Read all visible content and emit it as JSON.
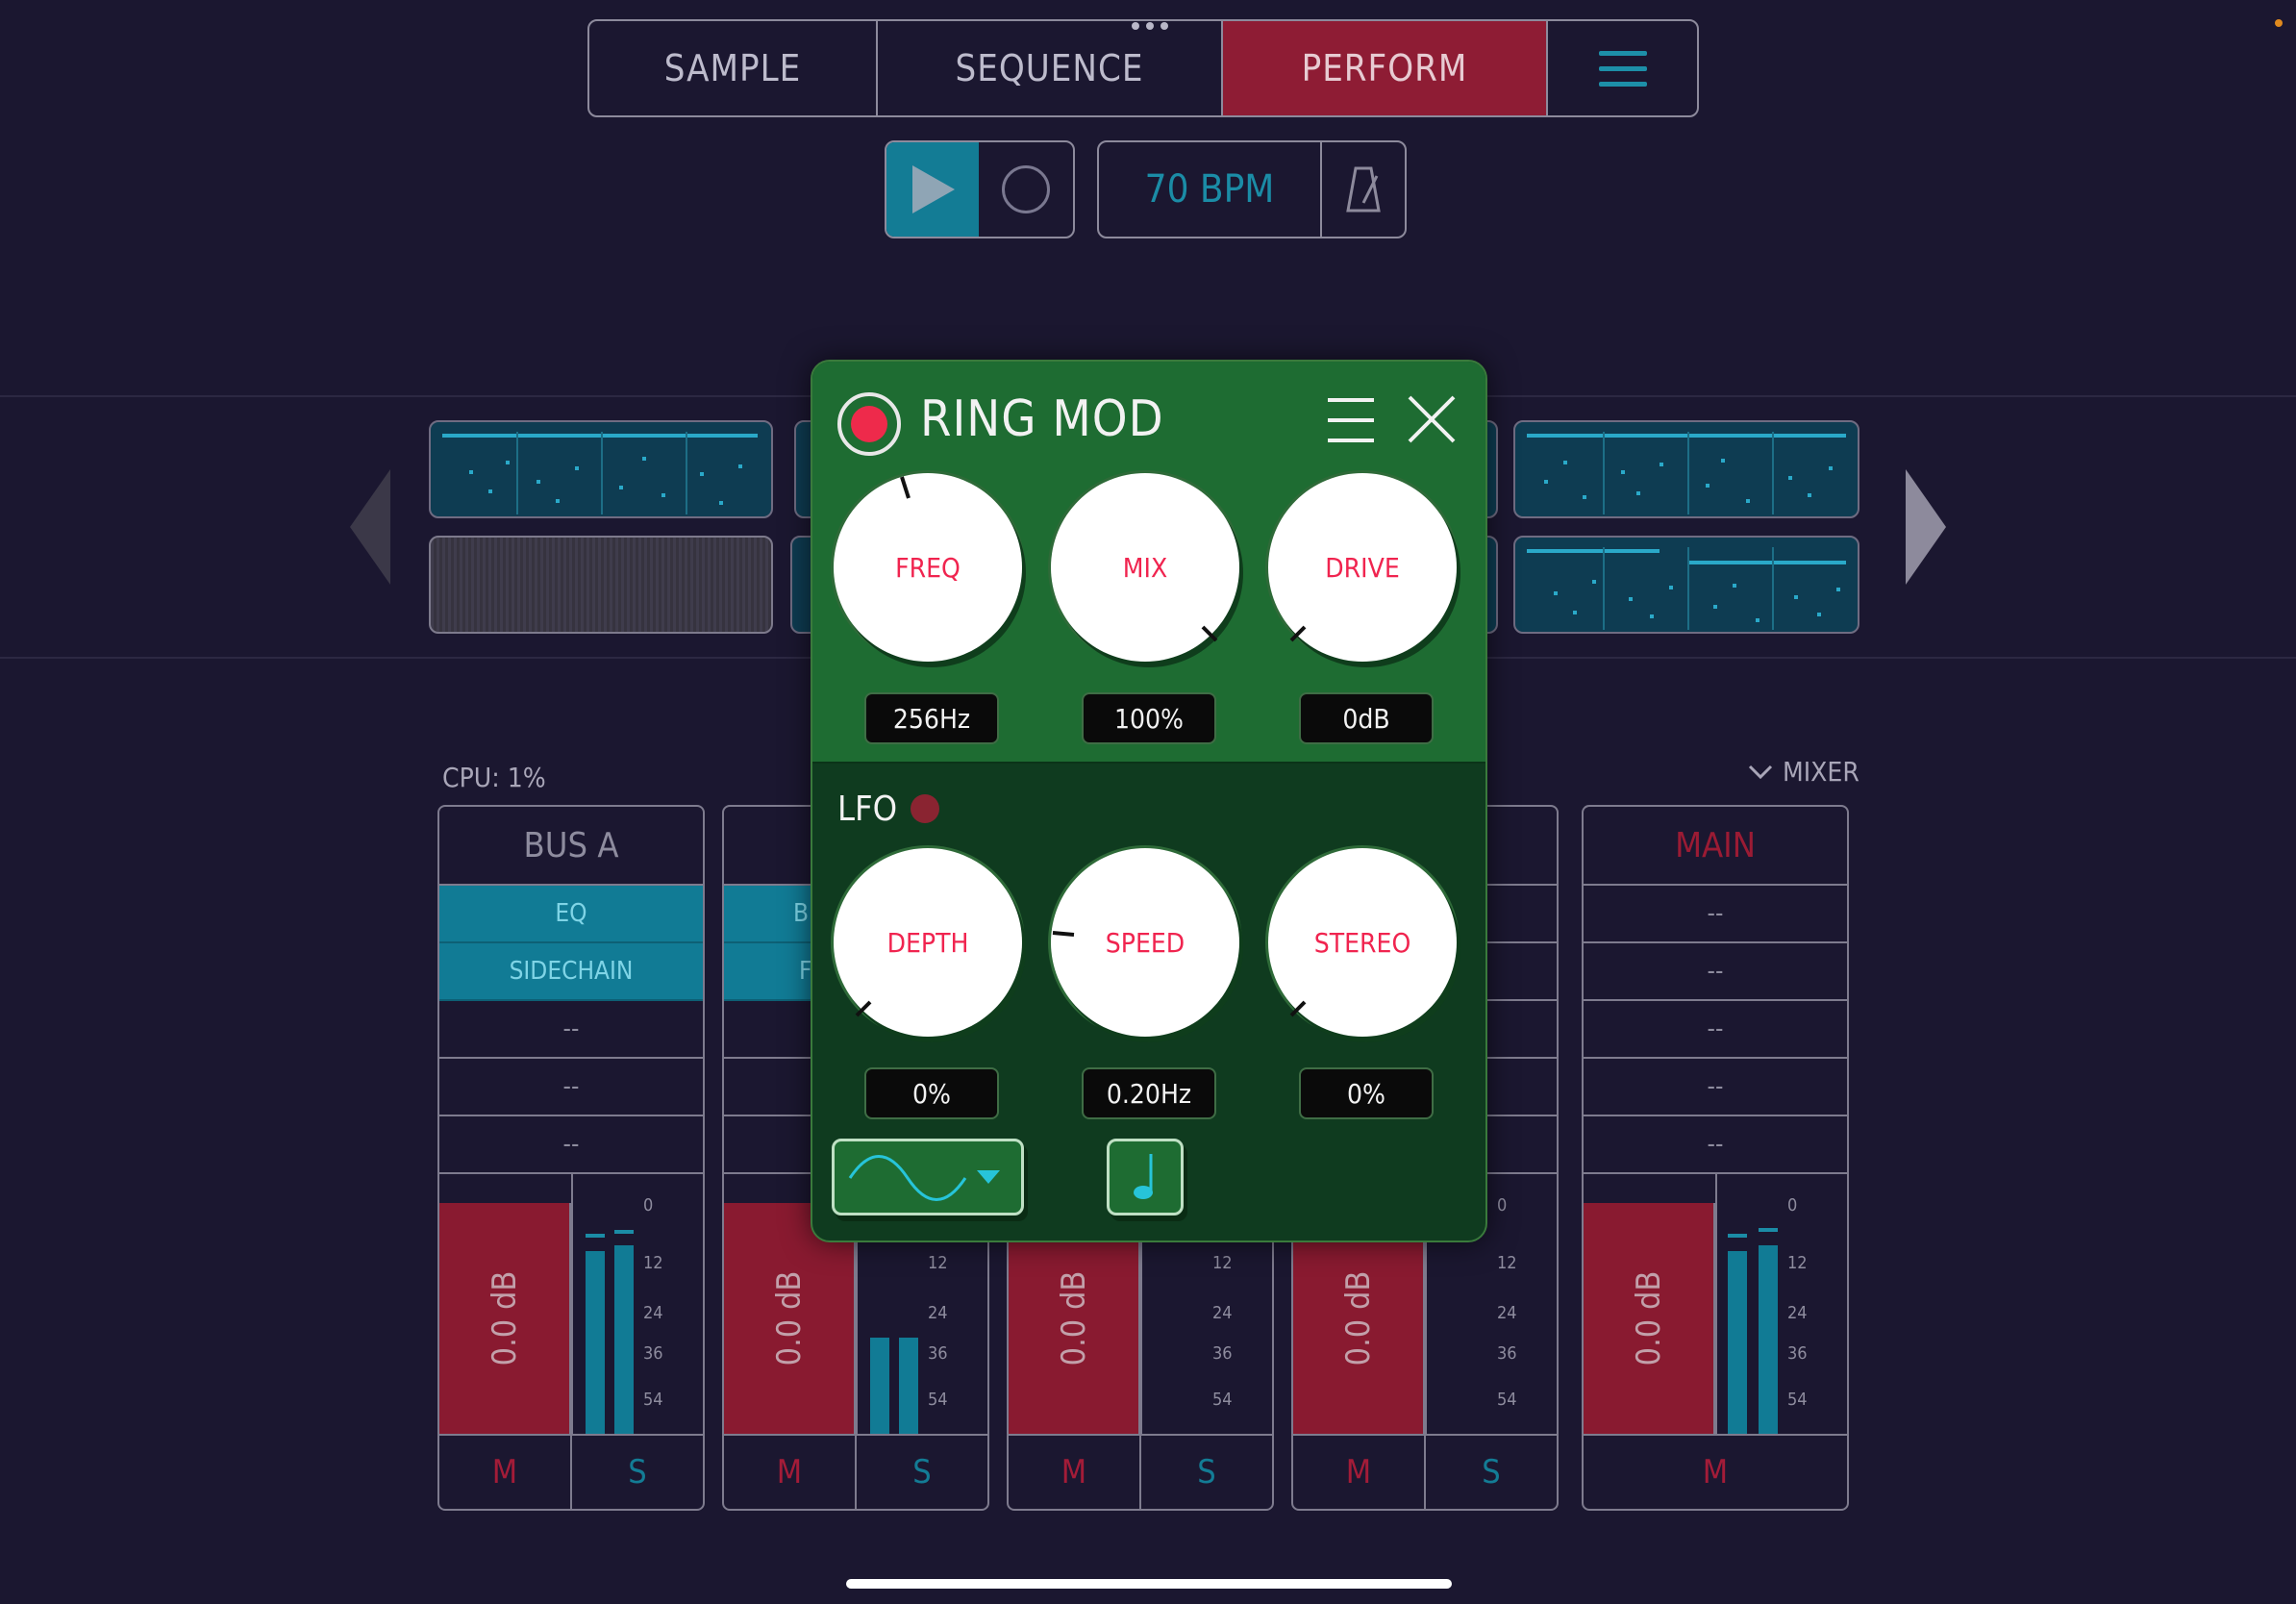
{
  "tabs": [
    {
      "label": "SAMPLE",
      "active": false
    },
    {
      "label": "SEQUENCE",
      "active": false
    },
    {
      "label": "PERFORM",
      "active": true
    }
  ],
  "transport": {
    "bpm": "70 BPM",
    "icons": [
      "play-icon",
      "record-icon",
      "metronome-icon",
      "menu-icon"
    ]
  },
  "mixer": {
    "cpu": "CPU: 1%",
    "toggle_label": "MIXER",
    "scale": [
      "0",
      "12",
      "24",
      "36",
      "54"
    ],
    "channels": [
      {
        "name": "BUS A",
        "slots": [
          "EQ",
          "SIDECHAIN",
          "--",
          "--",
          "--"
        ],
        "fader": "0.0 dB",
        "mute": "M",
        "solo": "S"
      },
      {
        "name": "",
        "slots": [
          "B",
          "F",
          "",
          "",
          ""
        ],
        "fader": "0.0 dB",
        "mute": "M",
        "solo": "S"
      },
      {
        "name": "",
        "slots": [
          "",
          "",
          "",
          "",
          ""
        ],
        "fader": "0.0 dB",
        "mute": "M",
        "solo": "S"
      },
      {
        "name": "",
        "slots": [
          "",
          "",
          "",
          "",
          ""
        ],
        "fader": "0.0 dB",
        "mute": "M",
        "solo": "S"
      },
      {
        "name": "MAIN",
        "slots": [
          "--",
          "--",
          "--",
          "--",
          "--"
        ],
        "fader": "0.0 dB",
        "mute": "M"
      }
    ]
  },
  "plugin": {
    "title": "RING MOD",
    "enabled": true,
    "knobs": [
      {
        "label": "FREQ",
        "value": "256Hz"
      },
      {
        "label": "MIX",
        "value": "100%"
      },
      {
        "label": "DRIVE",
        "value": "0dB"
      }
    ],
    "lfo": {
      "label": "LFO",
      "knobs": [
        {
          "label": "DEPTH",
          "value": "0%"
        },
        {
          "label": "SPEED",
          "value": "0.20Hz"
        },
        {
          "label": "STEREO",
          "value": "0%"
        }
      ],
      "waveform_icon": "sine-wave-icon",
      "sync_icon": "music-note-icon"
    }
  },
  "colors": {
    "background": "#1b1730",
    "accent_red": "#8e1c34",
    "accent_teal": "#137c95",
    "plugin_green": "#1e6c32",
    "knob_label": "#f0244f"
  }
}
